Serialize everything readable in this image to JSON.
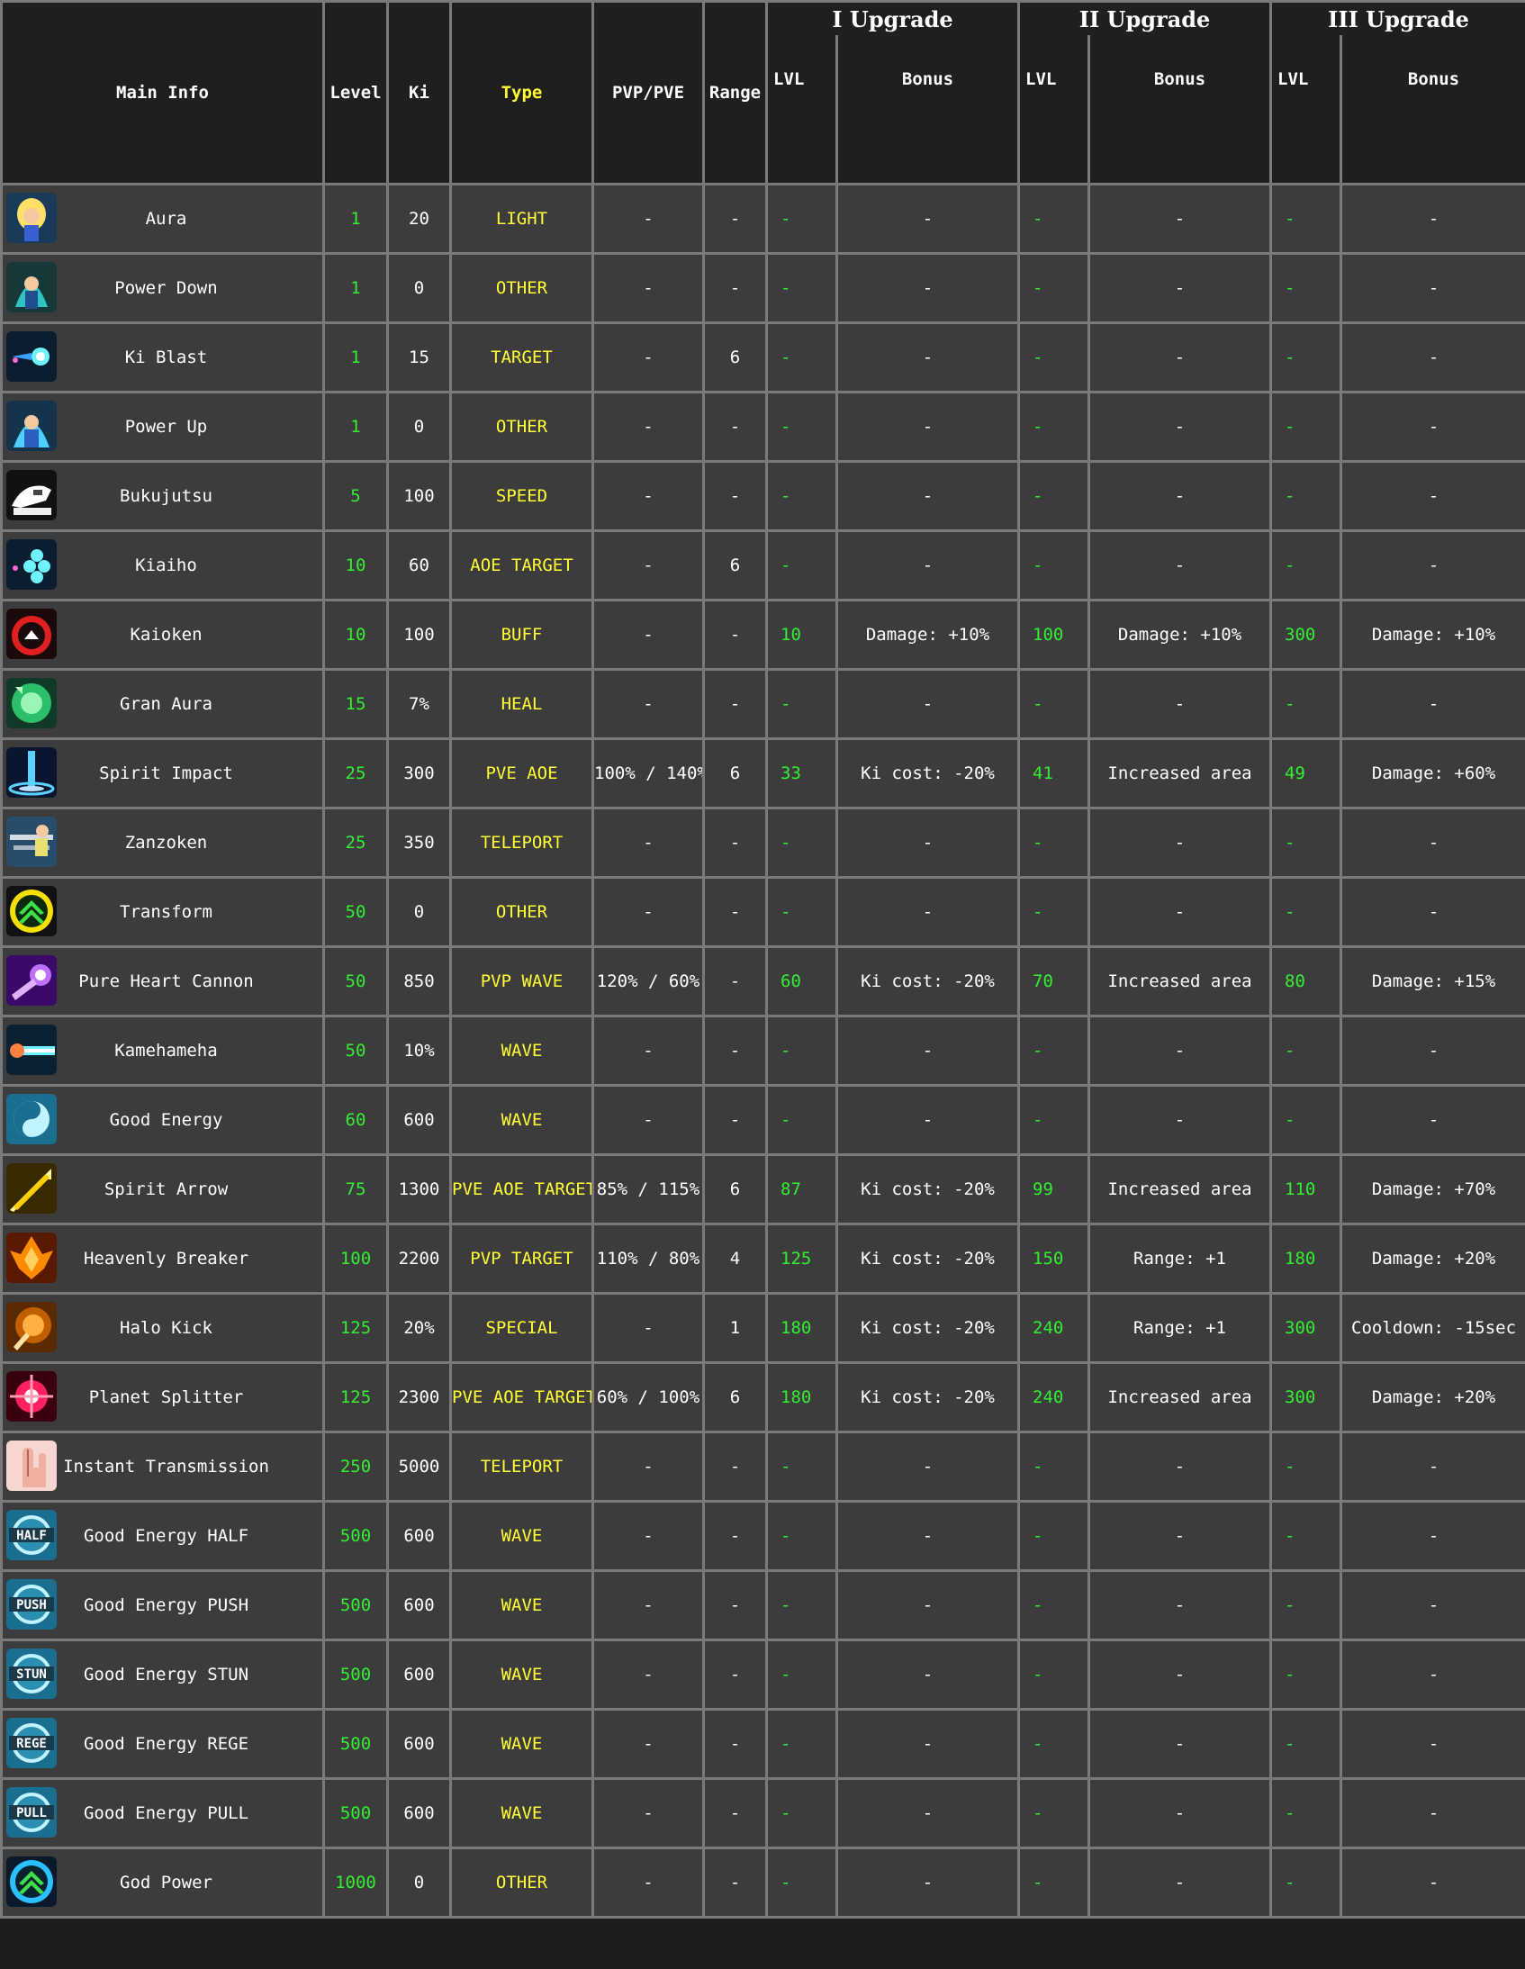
{
  "headers": {
    "main_info": "Main Info",
    "level": "Level",
    "ki": "Ki",
    "type": "Type",
    "pvp_pve": "PVP/PVE",
    "range": "Range",
    "upgrade1": "I Upgrade",
    "upgrade2": "II Upgrade",
    "upgrade3": "III Upgrade",
    "lvl": "LVL",
    "bonus": "Bonus"
  },
  "colors": {
    "level_text": "#33ee33",
    "type_text": "#ffff33",
    "cell_bg": "#3c3c3c",
    "header_bg": "#1f1f1f",
    "grid": "#7a7a7a"
  },
  "rows": [
    {
      "name": "Aura",
      "icon": "aura-icon",
      "level": "1",
      "ki": "20",
      "type": "LIGHT",
      "pvp": "-",
      "range": "-",
      "u1l": "-",
      "u1b": "-",
      "u2l": "-",
      "u2b": "-",
      "u3l": "-",
      "u3b": "-"
    },
    {
      "name": "Power Down",
      "icon": "power-down-icon",
      "level": "1",
      "ki": "0",
      "type": "OTHER",
      "pvp": "-",
      "range": "-",
      "u1l": "-",
      "u1b": "-",
      "u2l": "-",
      "u2b": "-",
      "u3l": "-",
      "u3b": "-"
    },
    {
      "name": "Ki Blast",
      "icon": "ki-blast-icon",
      "level": "1",
      "ki": "15",
      "type": "TARGET",
      "pvp": "-",
      "range": "6",
      "u1l": "-",
      "u1b": "-",
      "u2l": "-",
      "u2b": "-",
      "u3l": "-",
      "u3b": "-"
    },
    {
      "name": "Power Up",
      "icon": "power-up-icon",
      "level": "1",
      "ki": "0",
      "type": "OTHER",
      "pvp": "-",
      "range": "-",
      "u1l": "-",
      "u1b": "-",
      "u2l": "-",
      "u2b": "-",
      "u3l": "-",
      "u3b": "-"
    },
    {
      "name": "Bukujutsu",
      "icon": "bukujutsu-icon",
      "level": "5",
      "ki": "100",
      "type": "SPEED",
      "pvp": "-",
      "range": "-",
      "u1l": "-",
      "u1b": "-",
      "u2l": "-",
      "u2b": "-",
      "u3l": "-",
      "u3b": "-"
    },
    {
      "name": "Kiaiho",
      "icon": "kiaiho-icon",
      "level": "10",
      "ki": "60",
      "type": "AOE TARGET",
      "pvp": "-",
      "range": "6",
      "u1l": "-",
      "u1b": "-",
      "u2l": "-",
      "u2b": "-",
      "u3l": "-",
      "u3b": "-"
    },
    {
      "name": "Kaioken",
      "icon": "kaioken-icon",
      "level": "10",
      "ki": "100",
      "type": "BUFF",
      "pvp": "-",
      "range": "-",
      "u1l": "10",
      "u1b": "Damage: +10%",
      "u2l": "100",
      "u2b": "Damage: +10%",
      "u3l": "300",
      "u3b": "Damage: +10%"
    },
    {
      "name": "Gran Aura",
      "icon": "gran-aura-icon",
      "level": "15",
      "ki": "7%",
      "type": "HEAL",
      "pvp": "-",
      "range": "-",
      "u1l": "-",
      "u1b": "-",
      "u2l": "-",
      "u2b": "-",
      "u3l": "-",
      "u3b": "-"
    },
    {
      "name": "Spirit Impact",
      "icon": "spirit-impact-icon",
      "level": "25",
      "ki": "300",
      "type": "PVE AOE",
      "pvp": "100% / 140%",
      "range": "6",
      "u1l": "33",
      "u1b": "Ki cost: -20%",
      "u2l": "41",
      "u2b": "Increased area",
      "u3l": "49",
      "u3b": "Damage: +60%"
    },
    {
      "name": "Zanzoken",
      "icon": "zanzoken-icon",
      "level": "25",
      "ki": "350",
      "type": "TELEPORT",
      "pvp": "-",
      "range": "-",
      "u1l": "-",
      "u1b": "-",
      "u2l": "-",
      "u2b": "-",
      "u3l": "-",
      "u3b": "-"
    },
    {
      "name": "Transform",
      "icon": "transform-icon",
      "level": "50",
      "ki": "0",
      "type": "OTHER",
      "pvp": "-",
      "range": "-",
      "u1l": "-",
      "u1b": "-",
      "u2l": "-",
      "u2b": "-",
      "u3l": "-",
      "u3b": "-"
    },
    {
      "name": "Pure Heart Cannon",
      "icon": "pure-heart-cannon-icon",
      "level": "50",
      "ki": "850",
      "type": "PVP WAVE",
      "pvp": "120% / 60%",
      "range": "-",
      "u1l": "60",
      "u1b": "Ki cost: -20%",
      "u2l": "70",
      "u2b": "Increased area",
      "u3l": "80",
      "u3b": "Damage: +15%"
    },
    {
      "name": "Kamehameha",
      "icon": "kamehameha-icon",
      "level": "50",
      "ki": "10%",
      "type": "WAVE",
      "pvp": "-",
      "range": "-",
      "u1l": "-",
      "u1b": "-",
      "u2l": "-",
      "u2b": "-",
      "u3l": "-",
      "u3b": "-"
    },
    {
      "name": "Good Energy",
      "icon": "good-energy-icon",
      "level": "60",
      "ki": "600",
      "type": "WAVE",
      "pvp": "-",
      "range": "-",
      "u1l": "-",
      "u1b": "-",
      "u2l": "-",
      "u2b": "-",
      "u3l": "-",
      "u3b": "-"
    },
    {
      "name": "Spirit Arrow",
      "icon": "spirit-arrow-icon",
      "level": "75",
      "ki": "1300",
      "type": "PVE AOE TARGET",
      "pvp": "85% / 115%",
      "range": "6",
      "u1l": "87",
      "u1b": "Ki cost: -20%",
      "u2l": "99",
      "u2b": "Increased area",
      "u3l": "110",
      "u3b": "Damage: +70%"
    },
    {
      "name": "Heavenly Breaker",
      "icon": "heavenly-breaker-icon",
      "level": "100",
      "ki": "2200",
      "type": "PVP TARGET",
      "pvp": "110% / 80%",
      "range": "4",
      "u1l": "125",
      "u1b": "Ki cost: -20%",
      "u2l": "150",
      "u2b": "Range: +1",
      "u3l": "180",
      "u3b": "Damage: +20%"
    },
    {
      "name": "Halo Kick",
      "icon": "halo-kick-icon",
      "level": "125",
      "ki": "20%",
      "type": "SPECIAL",
      "pvp": "-",
      "range": "1",
      "u1l": "180",
      "u1b": "Ki cost: -20%",
      "u2l": "240",
      "u2b": "Range: +1",
      "u3l": "300",
      "u3b": "Cooldown: -15sec"
    },
    {
      "name": "Planet Splitter",
      "icon": "planet-splitter-icon",
      "level": "125",
      "ki": "2300",
      "type": "PVE AOE TARGET",
      "pvp": "60% / 100%",
      "range": "6",
      "u1l": "180",
      "u1b": "Ki cost: -20%",
      "u2l": "240",
      "u2b": "Increased area",
      "u3l": "300",
      "u3b": "Damage: +20%"
    },
    {
      "name": "Instant Transmission",
      "icon": "instant-transmission-icon",
      "level": "250",
      "ki": "5000",
      "type": "TELEPORT",
      "pvp": "-",
      "range": "-",
      "u1l": "-",
      "u1b": "-",
      "u2l": "-",
      "u2b": "-",
      "u3l": "-",
      "u3b": "-"
    },
    {
      "name": "Good Energy HALF",
      "icon": "half-icon",
      "tag": "HALF",
      "level": "500",
      "ki": "600",
      "type": "WAVE",
      "pvp": "-",
      "range": "-",
      "u1l": "-",
      "u1b": "-",
      "u2l": "-",
      "u2b": "-",
      "u3l": "-",
      "u3b": "-"
    },
    {
      "name": "Good Energy PUSH",
      "icon": "push-icon",
      "tag": "PUSH",
      "level": "500",
      "ki": "600",
      "type": "WAVE",
      "pvp": "-",
      "range": "-",
      "u1l": "-",
      "u1b": "-",
      "u2l": "-",
      "u2b": "-",
      "u3l": "-",
      "u3b": "-"
    },
    {
      "name": "Good Energy STUN",
      "icon": "stun-icon",
      "tag": "STUN",
      "level": "500",
      "ki": "600",
      "type": "WAVE",
      "pvp": "-",
      "range": "-",
      "u1l": "-",
      "u1b": "-",
      "u2l": "-",
      "u2b": "-",
      "u3l": "-",
      "u3b": "-"
    },
    {
      "name": "Good Energy REGE",
      "icon": "rege-icon",
      "tag": "REGE",
      "level": "500",
      "ki": "600",
      "type": "WAVE",
      "pvp": "-",
      "range": "-",
      "u1l": "-",
      "u1b": "-",
      "u2l": "-",
      "u2b": "-",
      "u3l": "-",
      "u3b": "-"
    },
    {
      "name": "Good Energy PULL",
      "icon": "pull-icon",
      "tag": "PULL",
      "level": "500",
      "ki": "600",
      "type": "WAVE",
      "pvp": "-",
      "range": "-",
      "u1l": "-",
      "u1b": "-",
      "u2l": "-",
      "u2b": "-",
      "u3l": "-",
      "u3b": "-"
    },
    {
      "name": "God Power",
      "icon": "god-power-icon",
      "level": "1000",
      "ki": "0",
      "type": "OTHER",
      "pvp": "-",
      "range": "-",
      "u1l": "-",
      "u1b": "-",
      "u2l": "-",
      "u2b": "-",
      "u3l": "-",
      "u3b": "-"
    }
  ]
}
